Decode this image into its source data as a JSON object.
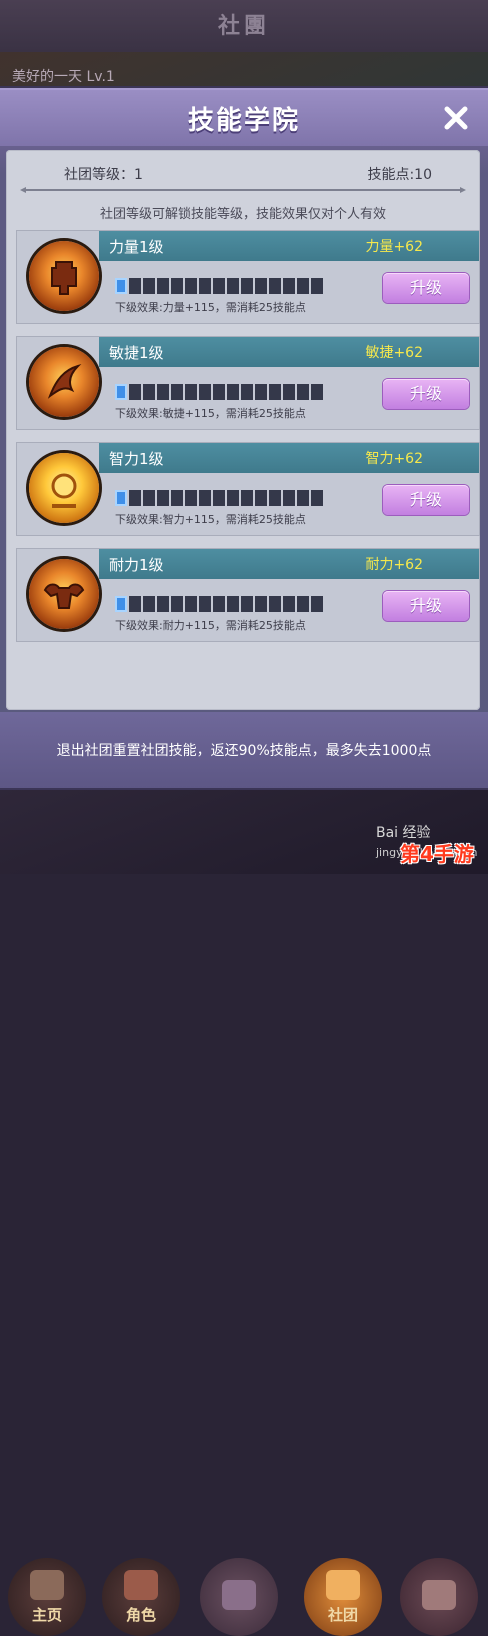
{
  "background": {
    "screen_title": "社團",
    "player_line": "美好的一天 Lv.1"
  },
  "nav": [
    {
      "label": "主页",
      "icon": "home-icon"
    },
    {
      "label": "角色",
      "icon": "helmet-icon"
    },
    {
      "label": "",
      "icon": "crossed-swords-icon"
    },
    {
      "label": "社团",
      "icon": "guild-icon"
    },
    {
      "label": "",
      "icon": "book-icon"
    }
  ],
  "modal": {
    "title": "技能学院",
    "close_icon": "close-icon",
    "guild_level": "社团等级：1",
    "skill_points": "技能点:10",
    "hint": "社团等级可解锁技能等级，技能效果仅对个人有效",
    "footer": "退出社团重置社团技能，返还90%技能点，最多失去1000点"
  },
  "skills": [
    {
      "name": "力量1级",
      "bonus": "力量+62",
      "next": "下级效果:力量+115，需消耗25技能点",
      "button": "升级",
      "icon": "strength-icon",
      "progress_filled": 1,
      "progress_total": 15
    },
    {
      "name": "敏捷1级",
      "bonus": "敏捷+62",
      "next": "下级效果:敏捷+115，需消耗25技能点",
      "button": "升级",
      "icon": "agility-icon",
      "progress_filled": 1,
      "progress_total": 15
    },
    {
      "name": "智力1级",
      "bonus": "智力+62",
      "next": "下级效果:智力+115，需消耗25技能点",
      "button": "升级",
      "icon": "intellect-icon",
      "progress_filled": 1,
      "progress_total": 15
    },
    {
      "name": "耐力1级",
      "bonus": "耐力+62",
      "next": "下级效果:耐力+115，需消耗25技能点",
      "button": "升级",
      "icon": "stamina-icon",
      "progress_filled": 1,
      "progress_total": 15
    }
  ],
  "watermark": {
    "baidu": "Bai 经验",
    "baidu_sub": "jingyan.baidu.com",
    "site": "第4手游"
  }
}
